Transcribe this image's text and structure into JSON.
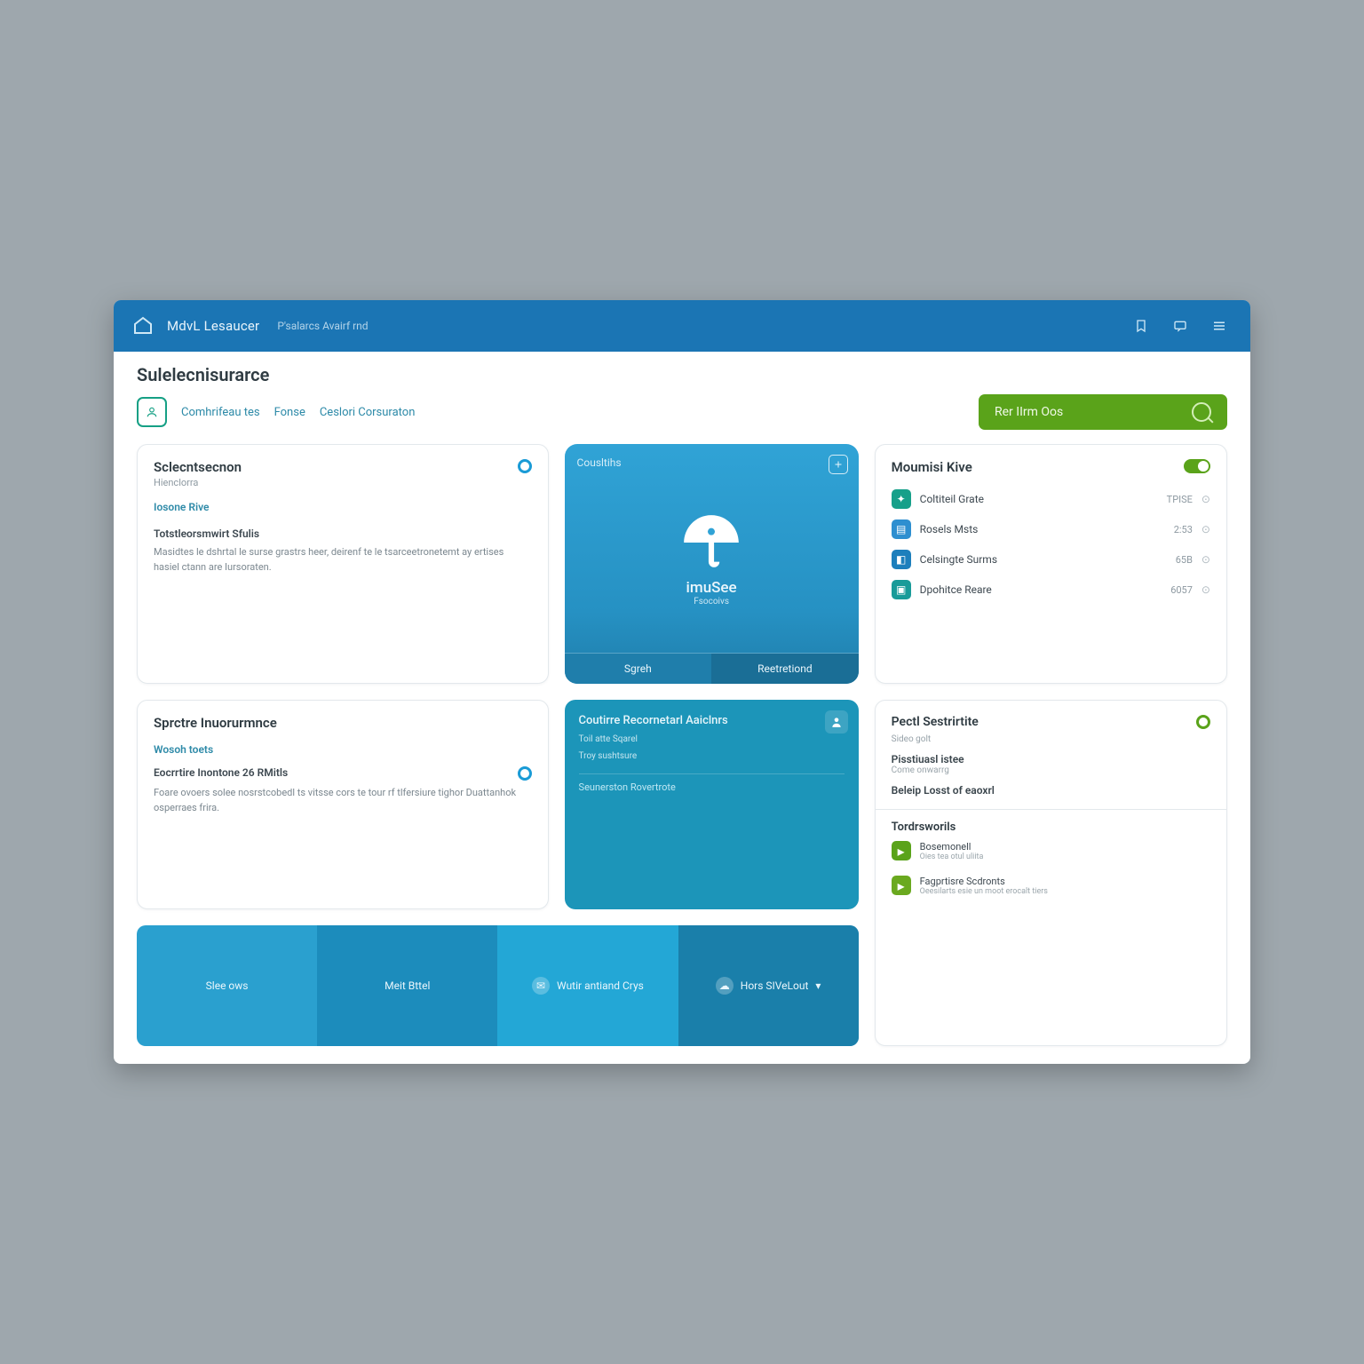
{
  "topbar": {
    "brand": "MdvL Lesaucer",
    "brand_sub": "P'salarcs Avairf rnd"
  },
  "page": {
    "title": "Sulelecnisurarce"
  },
  "tabs": {
    "t1": "Comhrifeau tes",
    "t2": "Fonse",
    "t3": "Ceslori Corsuraton"
  },
  "cta": {
    "label": "Rer IIrm Oos"
  },
  "card_selection": {
    "title": "Sclecntsecnon",
    "subtitle": "Hienclorra",
    "link": "Iosone Rive",
    "section": "Totstleorsmwirt Sfulis",
    "body": "Masidtes le dshrtal le surse grastrs heer, deirenf te le tsarceetronetemt ay ertises hasiel ctann are Iursoraten."
  },
  "tile_product": {
    "head": "Cousltihs",
    "name": "imuSee",
    "tag": "Fsocoivs",
    "left": "Sgreh",
    "right": "Reetretiond"
  },
  "list": {
    "title": "Moumisi Kive",
    "rows": [
      {
        "icon": "badge",
        "label": "Coltiteil Grate",
        "value": "TPISE"
      },
      {
        "icon": "doc",
        "label": "Rosels Msts",
        "value": "2:53"
      },
      {
        "icon": "tag",
        "label": "Celsingte Surms",
        "value": "65B"
      },
      {
        "icon": "box",
        "label": "Dpohitce Reare",
        "value": "6057"
      }
    ]
  },
  "card_spore": {
    "title": "Sprctre Inuorurmnce",
    "link": "Wosoh toets",
    "section": "Eocrrtire Inontone 26 RMitls",
    "body": "Foare ovoers solee nosrstcobedl ts vitsse cors te tour rf tlfersiure tighor Duattanhok osperraes frira."
  },
  "tile_confirm": {
    "title": "Coutirre Recornetarl Aaiclnrs",
    "line1": "Toil atte Sqarel",
    "line2": "Troy sushtsure",
    "footer": "Seunerston Rovertrote"
  },
  "panel": {
    "title": "Pectl Sestrirtite",
    "sub": "Sideo golt",
    "item1_t": "Pisstiuasl istee",
    "item1_s": "Come onwarrg",
    "item2_t": "Beleip Losst of eaoxrl"
  },
  "bottombar": {
    "seg1": "Slee ows",
    "seg2": "Meit Bttel",
    "seg3": "Wutir antiand Crys",
    "seg4": "Hors SIVeLout"
  },
  "trend": {
    "title": "Tordrsworils",
    "rows": [
      {
        "t": "Bosemonell",
        "s": "Oies tea otul uliita"
      },
      {
        "t": "Fagprtisre Scdronts",
        "s": "Oeesilarts esie un moot erocalt tiers"
      }
    ]
  }
}
